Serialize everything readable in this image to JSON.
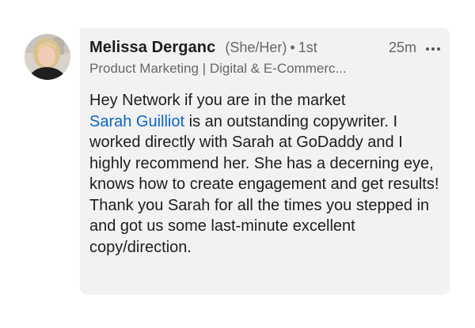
{
  "author": {
    "name": "Melissa Derganc",
    "pronouns": "(She/Her)",
    "separator": "•",
    "degree": "1st",
    "headline": "Product Marketing | Digital & E-Commerc..."
  },
  "comment": {
    "timestamp": "25m",
    "line1": "Hey Network if you are in the market",
    "mention": "Sarah Guilliot",
    "rest": " is an outstanding copywriter.  I worked directly with Sarah at GoDaddy and I highly recommend her. She has a decerning eye, knows how to create engagement and get results! Thank you Sarah for all the times you stepped in and got us some last-minute excellent copy/direction."
  },
  "icons": {
    "more": "more-horizontal-icon",
    "avatar": "profile-photo"
  },
  "colors": {
    "bubble": "#f2f2f2",
    "mention": "#0a66c2",
    "secondary_text": "#666666"
  }
}
